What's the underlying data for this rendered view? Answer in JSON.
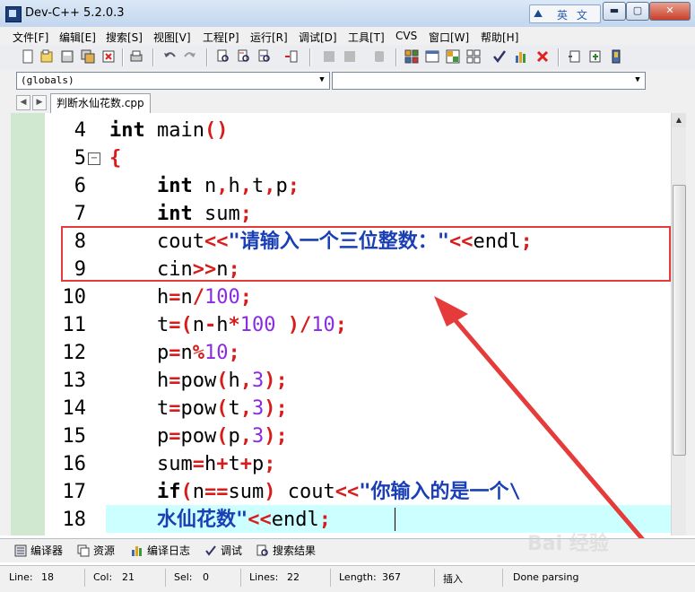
{
  "window": {
    "title": "Dev-C++ 5.2.0.3",
    "ime_label": "英 文"
  },
  "menu": [
    "文件[F]",
    "编辑[E]",
    "搜索[S]",
    "视图[V]",
    "工程[P]",
    "运行[R]",
    "调试[D]",
    "工具[T]",
    "CVS",
    "窗口[W]",
    "帮助[H]"
  ],
  "combos": {
    "left_value": "(globals)",
    "right_value": ""
  },
  "tabs": {
    "file": "判断水仙花数.cpp"
  },
  "code_lines": [
    {
      "num": "4"
    },
    {
      "num": "5"
    },
    {
      "num": "6"
    },
    {
      "num": "7"
    },
    {
      "num": "8"
    },
    {
      "num": "9"
    },
    {
      "num": "10"
    },
    {
      "num": "11"
    },
    {
      "num": "12"
    },
    {
      "num": "13"
    },
    {
      "num": "14"
    },
    {
      "num": "15"
    },
    {
      "num": "16"
    },
    {
      "num": "17"
    },
    {
      "num": "18"
    }
  ],
  "code_text": {
    "l4": "int main()",
    "l8_str": "\"请输入一个三位整数：\"",
    "l17_str": "\"你输入的是一个\\",
    "l18_str": "水仙花数\""
  },
  "bottom_tabs": [
    "编译器",
    "资源",
    "编译日志",
    "调试",
    "搜索结果"
  ],
  "status": {
    "line_label": "Line:",
    "line": "18",
    "col_label": "Col:",
    "col": "21",
    "sel_label": "Sel:",
    "sel": "0",
    "lines_label": "Lines:",
    "lines": "22",
    "length_label": "Length:",
    "length": "367",
    "mode": "插入",
    "parse": "Done parsing"
  },
  "watermark": "Bai 经验",
  "colors": {
    "accent_red": "#e63b3b",
    "current_line": "#ccffff",
    "gutter_green": "#cfe8cf",
    "string_blue": "#1a3fb5",
    "number_purple": "#8a2be2"
  }
}
